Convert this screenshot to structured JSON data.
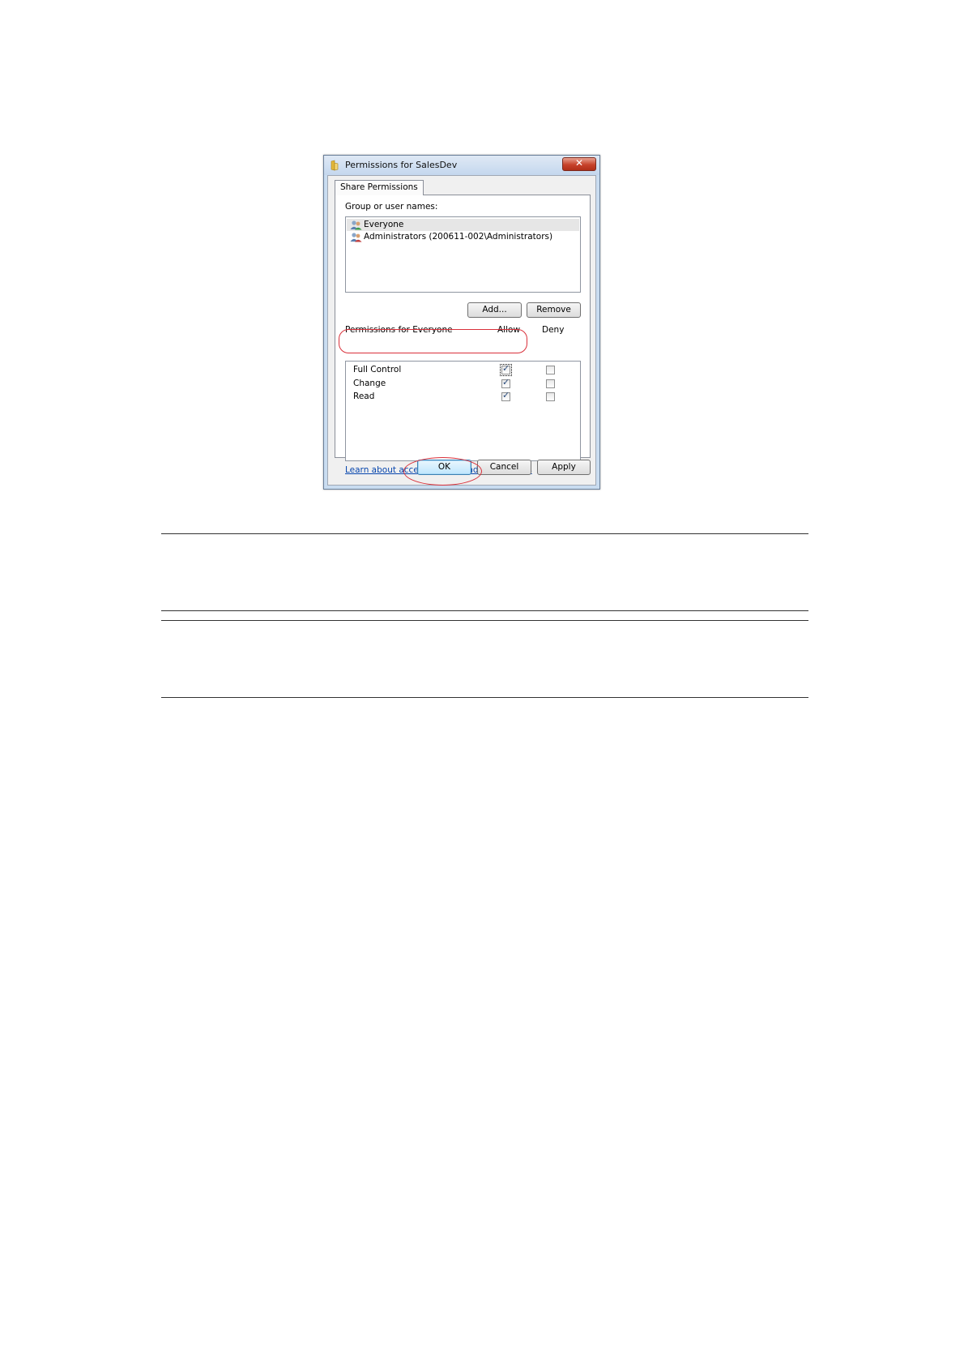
{
  "dialog": {
    "title": "Permissions for SalesDev",
    "close_symbol": "✕",
    "tab_label": "Share Permissions",
    "group_label": "Group or user names:",
    "users": [
      {
        "name": "Everyone",
        "selected": true
      },
      {
        "name": "Administrators (200611-002\\Administrators)",
        "selected": false
      }
    ],
    "add_label": "Add...",
    "remove_label": "Remove",
    "permissions_label": "Permissions for Everyone",
    "allow_header": "Allow",
    "deny_header": "Deny",
    "permissions": [
      {
        "name": "Full Control",
        "allow": true,
        "deny": false
      },
      {
        "name": "Change",
        "allow": true,
        "deny": false
      },
      {
        "name": "Read",
        "allow": true,
        "deny": false
      }
    ],
    "learn_link": "Learn about access control and permissions",
    "ok_label": "OK",
    "cancel_label": "Cancel",
    "apply_label": "Apply",
    "icons": {
      "title": "shared-folder-icon",
      "user": "user-group-icon",
      "close": "close-icon"
    }
  },
  "annotation_color": "#d9303a"
}
